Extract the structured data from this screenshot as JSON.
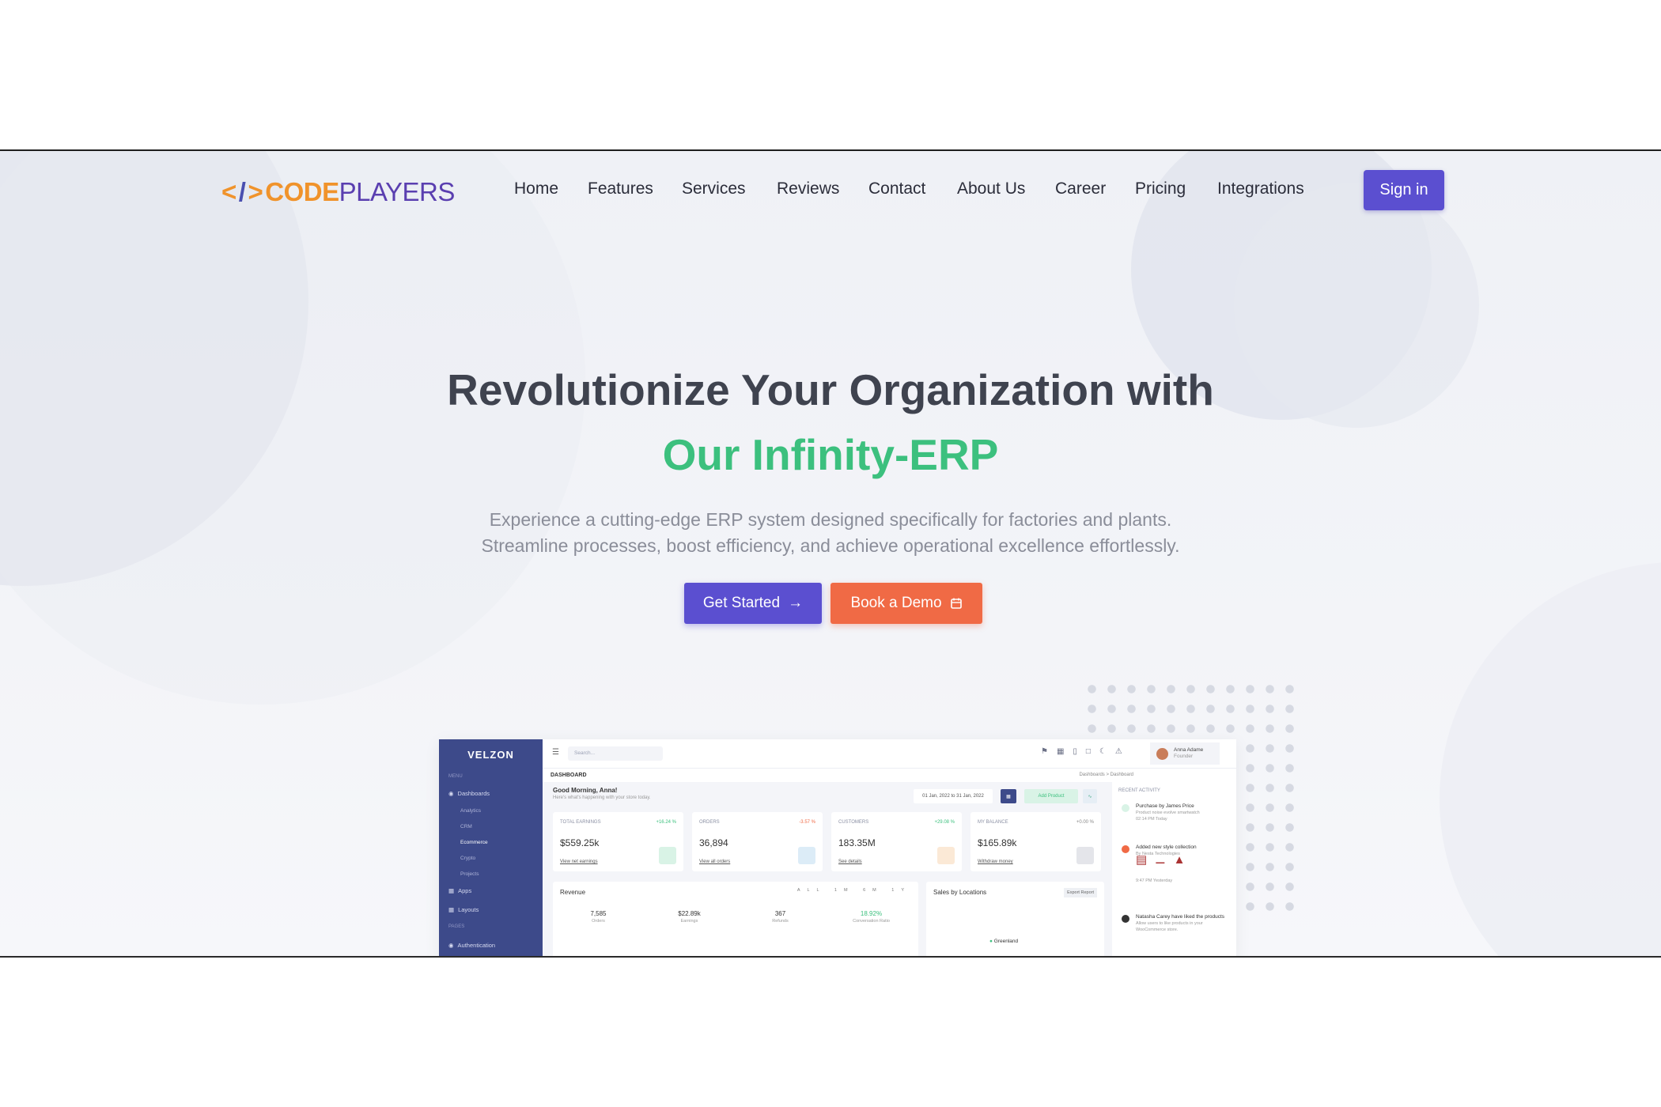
{
  "brand": {
    "bracket_open": "</",
    "slash": "",
    "bracket_close": ">",
    "code": "CODE",
    "players": "PLAYERS"
  },
  "nav": {
    "items": [
      "Home",
      "Features",
      "Services",
      "Reviews",
      "Contact",
      "About Us",
      "Career",
      "Pricing",
      "Integrations"
    ],
    "signin_label": "Sign in"
  },
  "hero": {
    "title_line1": "Revolutionize Your Organization with",
    "title_line2": "Our Infinity-ERP",
    "subtitle_line1": "Experience a cutting-edge ERP system designed specifically for factories and plants.",
    "subtitle_line2": "Streamline processes, boost efficiency, and achieve operational excellence effortlessly.",
    "cta_primary": "Get Started",
    "cta_secondary": "Book a Demo"
  },
  "colors": {
    "primary": "#5b4fd0",
    "accent_green": "#3cc07e",
    "accent_orange": "#f06a45",
    "logo_orange": "#f0932b",
    "logo_purple": "#5a3fb0"
  },
  "dashboard": {
    "brand": "VELZON",
    "menu_label": "MENU",
    "pages_label": "PAGES",
    "sidebar": {
      "dashboards": "Dashboards",
      "subs": [
        "Analytics",
        "CRM",
        "Ecommerce",
        "Crypto",
        "Projects"
      ],
      "apps": "Apps",
      "layouts": "Layouts",
      "auth": "Authentication"
    },
    "search_placeholder": "Search...",
    "user_name": "Anna Adame",
    "user_role": "Founder",
    "section": "DASHBOARD",
    "crumb": "Dashboards  >  Dashboard",
    "greeting": "Good Morning, Anna!",
    "greeting_sub": "Here's what's happening with your store today.",
    "date_range": "01 Jan, 2022 to 31 Jan, 2022",
    "add_product": "Add Product",
    "cards": [
      {
        "title": "TOTAL EARNINGS",
        "pct": "+16.24 %",
        "value": "$559.25k",
        "link": "View net earnings"
      },
      {
        "title": "ORDERS",
        "pct": "-3.57 %",
        "value": "36,894",
        "link": "View all orders"
      },
      {
        "title": "CUSTOMERS",
        "pct": "+29.08 %",
        "value": "183.35M",
        "link": "See details"
      },
      {
        "title": "MY BALANCE",
        "pct": "+0.00 %",
        "value": "$165.89k",
        "link": "Withdraw money"
      }
    ],
    "revenue": {
      "title": "Revenue",
      "stats": [
        {
          "value": "7,585",
          "label": "Orders"
        },
        {
          "value": "$22.89k",
          "label": "Earnings"
        },
        {
          "value": "367",
          "label": "Refunds"
        },
        {
          "value": "18.92%",
          "label": "Conversation Ratio"
        }
      ],
      "buttons": "ALL 1M 6M 1Y"
    },
    "sales": {
      "title": "Sales by Locations",
      "export": "Export Report",
      "legend": "Greenland"
    },
    "activity": {
      "title": "RECENT ACTIVITY",
      "e1_title": "Purchase by James Price",
      "e1_sub": "Product noise evolve smartwatch",
      "e1_time": "02:14 PM Today",
      "e2_title": "Added new style collection",
      "e2_sub": "By Nesta Technologies",
      "e2_time": "9:47 PM Yesterday",
      "e3_title": "Natasha Carey have liked the products",
      "e3_sub": "Allow users to like products in your WooCommerce store."
    }
  }
}
